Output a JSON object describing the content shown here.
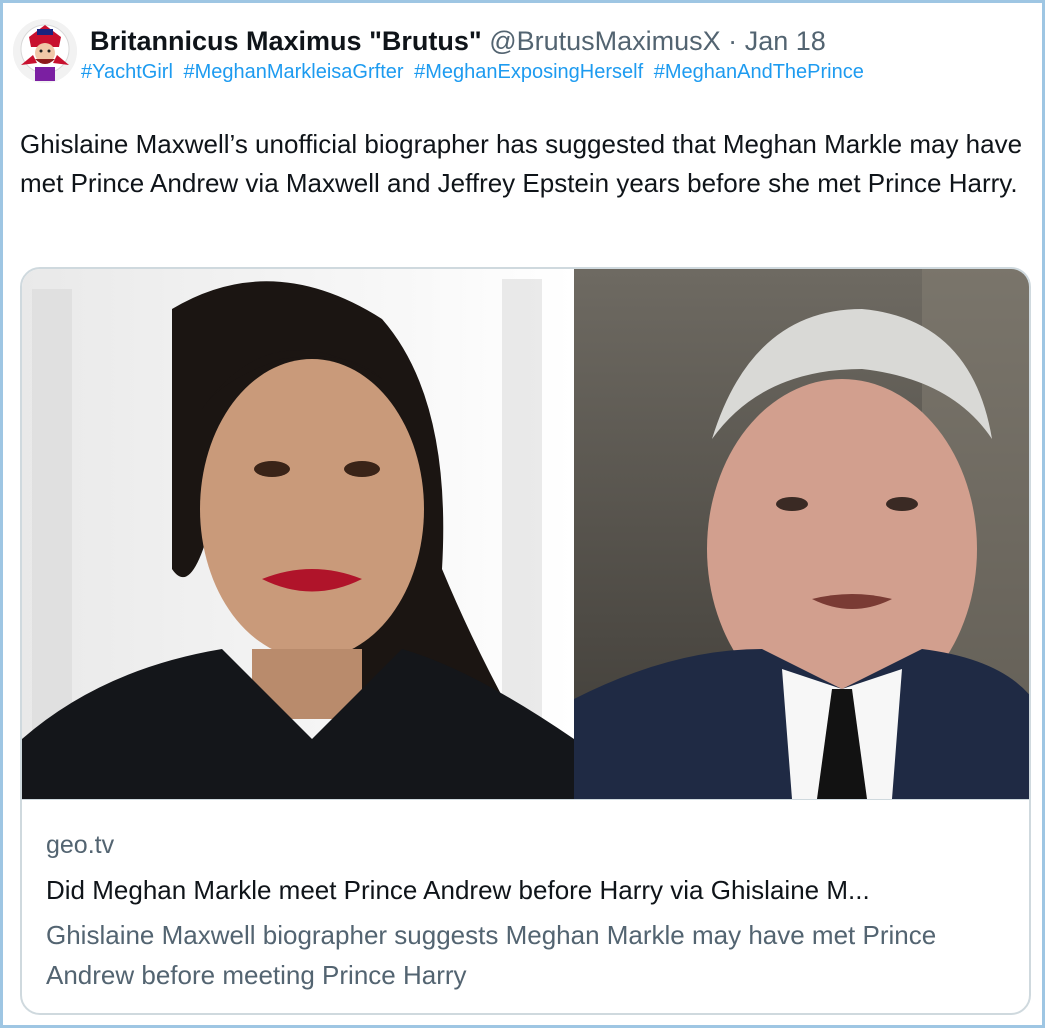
{
  "tweet": {
    "display_name": "Britannicus Maximus \"Brutus\"",
    "handle": "@BrutusMaximusX",
    "separator": "·",
    "date": "Jan 18",
    "hashtags": [
      "#YachtGirl",
      "#MeghanMarkleisaGrfter",
      "#MeghanExposingHerself",
      "#MeghanAndThePrince"
    ],
    "text": "Ghislaine Maxwell’s unofficial biographer has suggested that Meghan Markle may have met Prince Andrew via Maxwell and Jeffrey Epstein years before she met Prince Harry."
  },
  "card": {
    "domain": "geo.tv",
    "title": "Did Meghan Markle meet Prince Andrew before Harry via Ghislaine M...",
    "description": "Ghislaine Maxwell biographer suggests Meghan Markle may have met Prince Andrew before meeting Prince Harry"
  },
  "colors": {
    "link": "#1d9bf0",
    "secondary_text": "#536471",
    "primary_text": "#0f1419",
    "border": "#cfd9de",
    "frame": "#9ec6e3"
  },
  "icons": {
    "avatar": "cartoon-soldier-avatar"
  }
}
